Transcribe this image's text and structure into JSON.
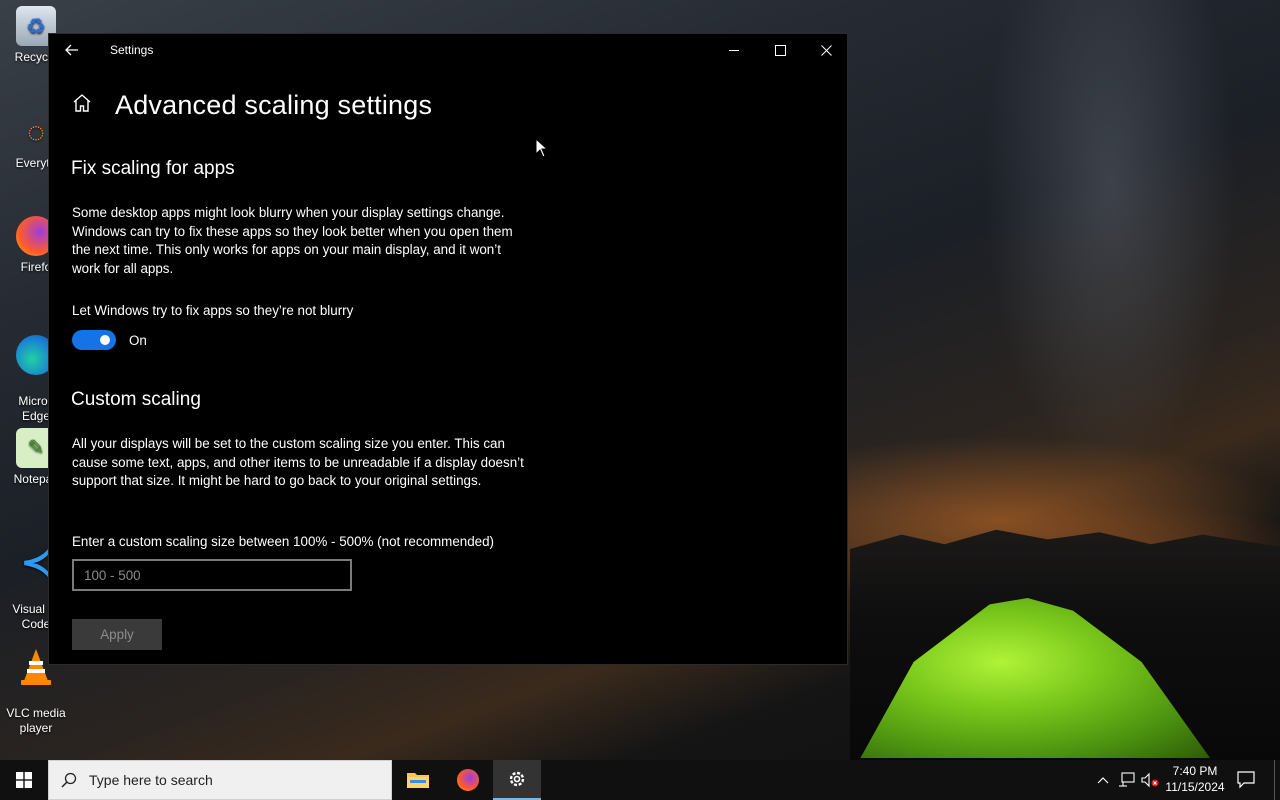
{
  "desktop": {
    "icons": [
      {
        "label": "Recycle",
        "icon": "recycle-bin-icon"
      },
      {
        "label": "Everyth",
        "icon": "everything-icon"
      },
      {
        "label": "Firefo",
        "icon": "firefox-icon"
      },
      {
        "label": "Micros\nEdge",
        "icon": "edge-icon"
      },
      {
        "label": "Notepac",
        "icon": "notepad-icon"
      },
      {
        "label": "Visual St\nCode",
        "icon": "vscode-icon"
      },
      {
        "label": "VLC media\nplayer",
        "icon": "vlc-icon"
      }
    ]
  },
  "window": {
    "title": "Settings",
    "back_icon": "back-arrow-icon",
    "minimize_icon": "minimize-icon",
    "maximize_icon": "maximize-icon",
    "close_icon": "close-icon"
  },
  "page": {
    "title": "Advanced scaling settings",
    "home_icon": "home-icon",
    "fix_section": {
      "title": "Fix scaling for apps",
      "description": "Some desktop apps might look blurry when your display settings change. Windows can try to fix these apps so they look better when you open them the next time. This only works for apps on your main display, and it won’t work for all apps.",
      "toggle_label": "Let Windows try to fix apps so they’re not blurry",
      "toggle_state": "On",
      "toggle_on": true
    },
    "custom_section": {
      "title": "Custom scaling",
      "description": "All your displays will be set to the custom scaling size you enter. This can cause some text, apps, and other items to be unreadable if a display doesn’t support that size. It might be hard to go back to your original settings.",
      "input_label": "Enter a custom scaling size between 100% - 500% (not recommended)",
      "input_placeholder": "100 - 500",
      "input_value": "",
      "apply_label": "Apply"
    }
  },
  "taskbar": {
    "search_placeholder": "Type here to search",
    "apps": [
      {
        "name": "file-explorer-icon"
      },
      {
        "name": "firefox-icon"
      },
      {
        "name": "settings-gear-icon",
        "active": true
      }
    ],
    "clock_time": "7:40 PM",
    "clock_date": "11/15/2024",
    "accent_color": "#76b9ed"
  },
  "colors": {
    "toggle_on": "#1473e6",
    "window_bg": "#000000",
    "apply_disabled_bg": "#3a3a3a"
  }
}
